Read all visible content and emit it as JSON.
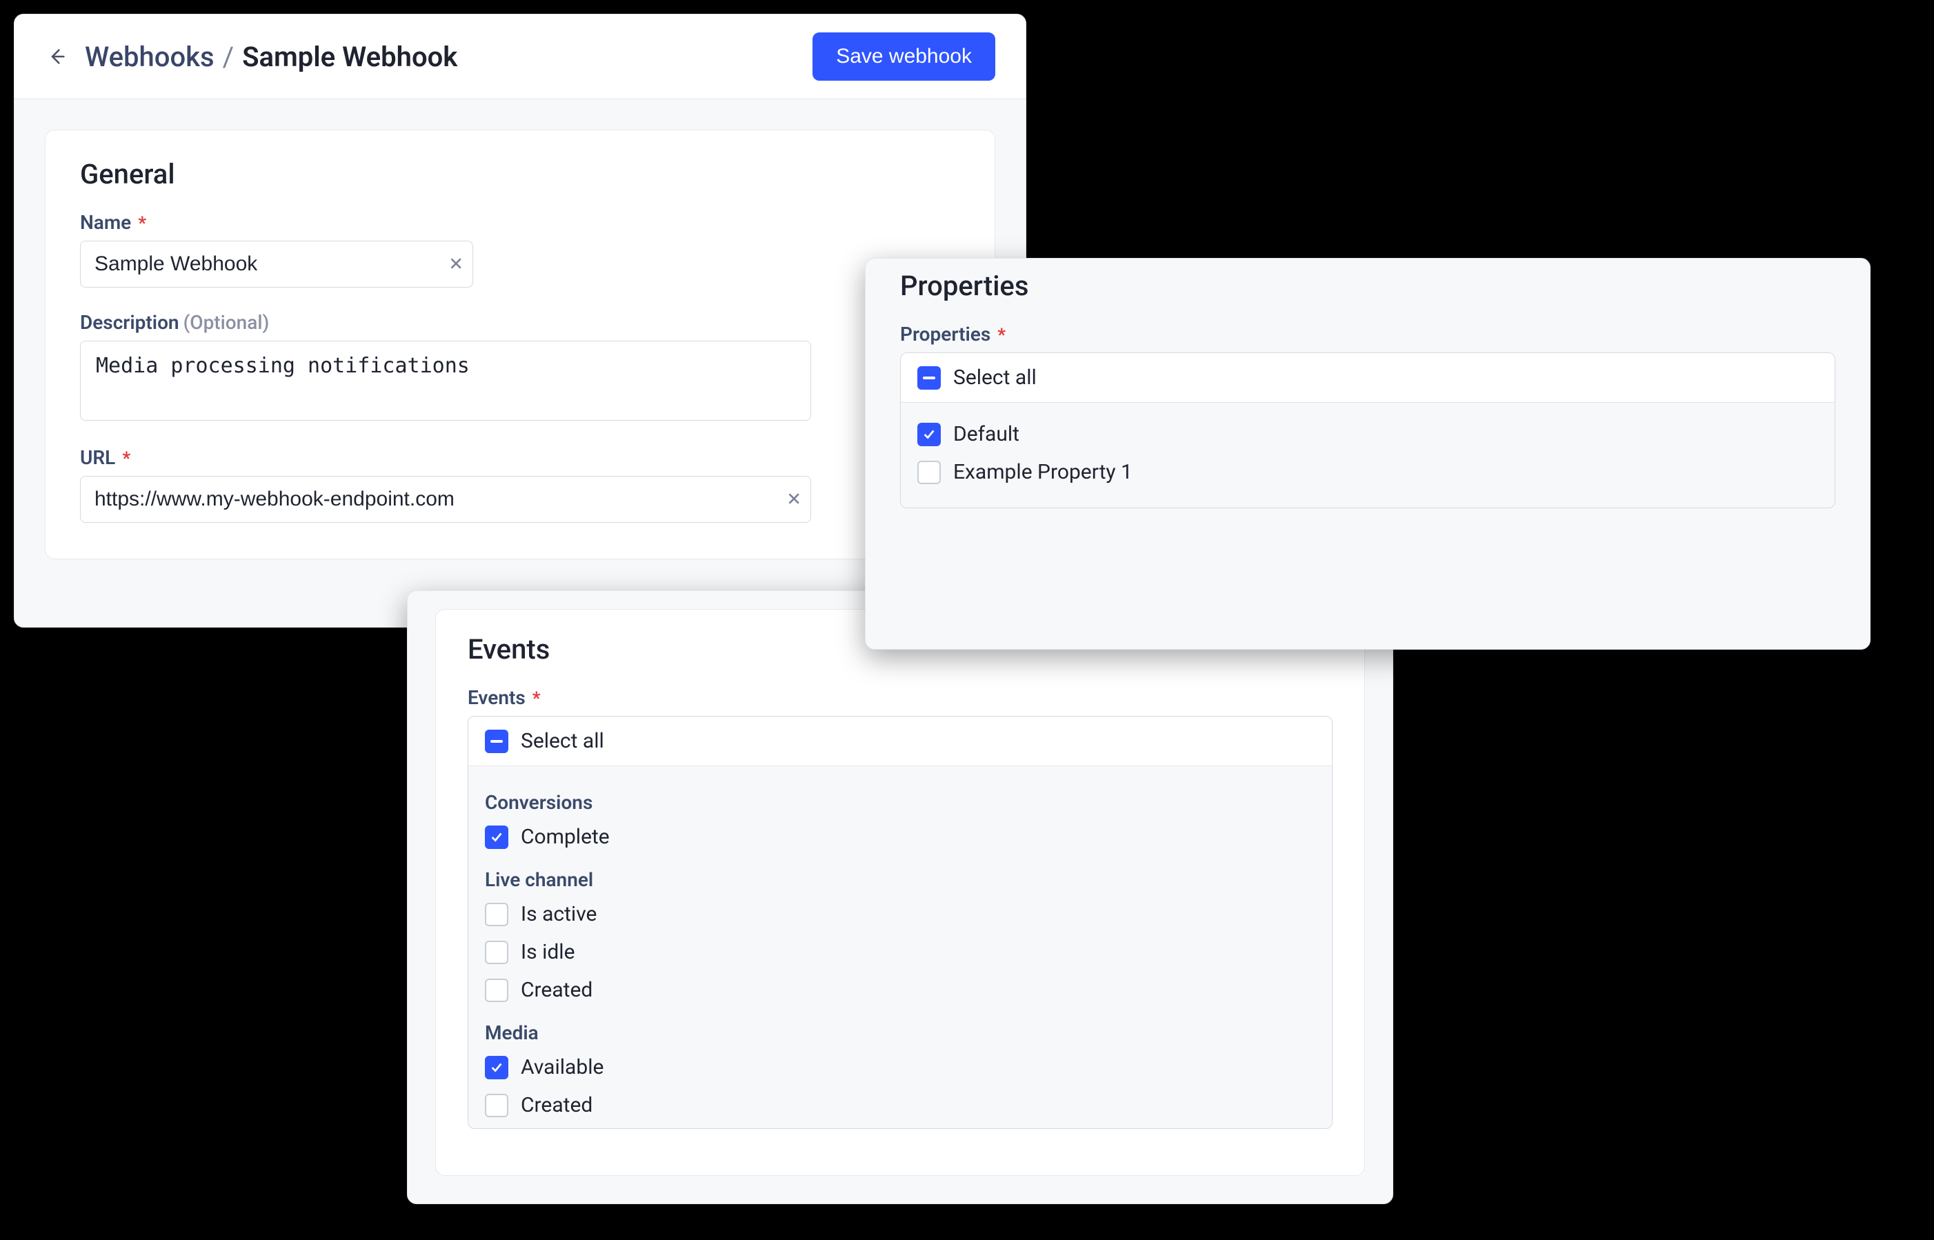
{
  "header": {
    "breadcrumb_root": "Webhooks",
    "breadcrumb_sep": "/",
    "breadcrumb_current": "Sample Webhook",
    "save_label": "Save webhook"
  },
  "general": {
    "section_title": "General",
    "name_label": "Name",
    "name_value": "Sample Webhook",
    "description_label": "Description",
    "description_optional": "(Optional)",
    "description_value": "Media processing notifications",
    "url_label": "URL",
    "url_value": "https://www.my-webhook-endpoint.com"
  },
  "properties": {
    "section_title": "Properties",
    "field_label": "Properties",
    "select_all_label": "Select all",
    "items": [
      {
        "label": "Default",
        "checked": true
      },
      {
        "label": "Example Property 1",
        "checked": false
      }
    ]
  },
  "events": {
    "section_title": "Events",
    "field_label": "Events",
    "select_all_label": "Select all",
    "groups": [
      {
        "title": "Conversions",
        "items": [
          {
            "label": "Complete",
            "checked": true
          }
        ]
      },
      {
        "title": "Live channel",
        "items": [
          {
            "label": "Is active",
            "checked": false
          },
          {
            "label": "Is idle",
            "checked": false
          },
          {
            "label": "Created",
            "checked": false
          }
        ]
      },
      {
        "title": "Media",
        "items": [
          {
            "label": "Available",
            "checked": true
          },
          {
            "label": "Created",
            "checked": false
          }
        ]
      }
    ]
  }
}
